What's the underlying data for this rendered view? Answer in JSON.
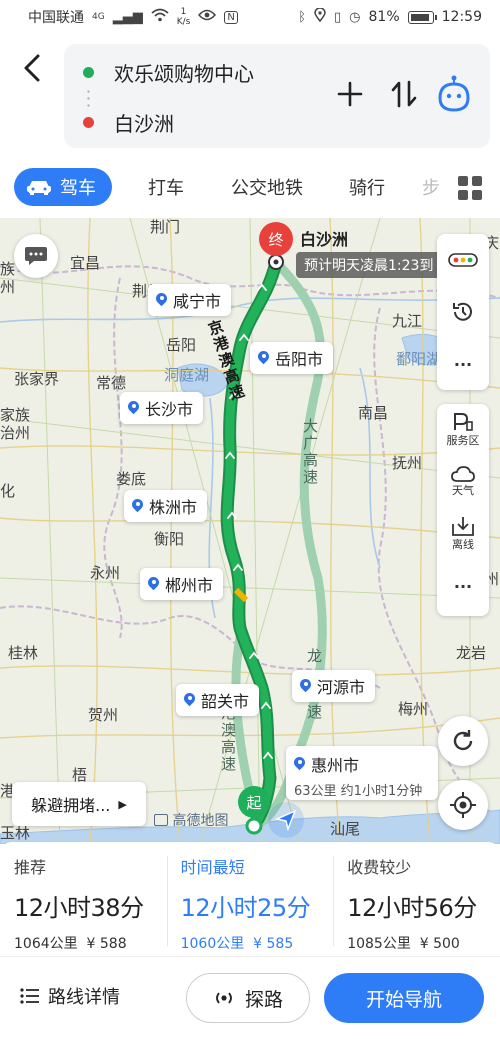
{
  "status_bar": {
    "carrier": "中国联通",
    "network": "4G",
    "speed_value": "1",
    "speed_unit": "K/s",
    "battery": "81%",
    "time": "12:59"
  },
  "route": {
    "origin": "欢乐颂购物中心",
    "destination": "白沙洲",
    "origin_color": "#1fae5a",
    "destination_color": "#e8403a"
  },
  "tabs": [
    {
      "label": "驾车",
      "active": true
    },
    {
      "label": "打车"
    },
    {
      "label": "公交地铁"
    },
    {
      "label": "骑行"
    },
    {
      "label": "步"
    }
  ],
  "map": {
    "cities": [
      "荆门",
      "宜昌",
      "荆州",
      "岳阳",
      "洞庭湖",
      "张家界",
      "常德",
      "九江",
      "鄱阳湖",
      "南昌",
      "抚州",
      "娄底",
      "衡阳",
      "永州",
      "桂林",
      "贺州",
      "龙岩",
      "梅州",
      "汕尾",
      "家族",
      "治州",
      "化",
      "族",
      "州",
      "港",
      "玉林",
      "梧",
      "庆",
      "州"
    ],
    "pois": [
      "咸宁市",
      "岳阳市",
      "长沙市",
      "株洲市",
      "郴州市",
      "韶关市",
      "河源市"
    ],
    "highways": [
      "京港澳高速",
      "大广高速",
      "龙",
      "速",
      "京港澳高速"
    ],
    "end_marker": "终",
    "start_marker": "起",
    "destination_label": "白沙洲",
    "eta_tip": "预计明天凌晨1:23到",
    "leg": {
      "city": "惠州市",
      "detail": "63公里 约1小时1分钟"
    },
    "brand": "高德地图",
    "avoid_label": "躲避拥堵...",
    "side_panel": {
      "service_area": "服务区",
      "weather": "天气",
      "offline": "离线",
      "more": "···"
    },
    "route_color": "#22b25a",
    "alt_route_color": "#9fd1b0"
  },
  "route_options": [
    {
      "label": "推荐",
      "duration": "12小时38分",
      "distance": "1064公里",
      "toll": "¥ 588",
      "selected": false
    },
    {
      "label": "时间最短",
      "duration": "12小时25分",
      "distance": "1060公里",
      "toll": "¥ 585",
      "selected": true
    },
    {
      "label": "收费较少",
      "duration": "12小时56分",
      "distance": "1085公里",
      "toll": "¥ 500",
      "selected": false
    }
  ],
  "bottom_bar": {
    "details": "路线详情",
    "explore": "探路",
    "navigate": "开始导航"
  },
  "accent_color": "#2f7df6"
}
